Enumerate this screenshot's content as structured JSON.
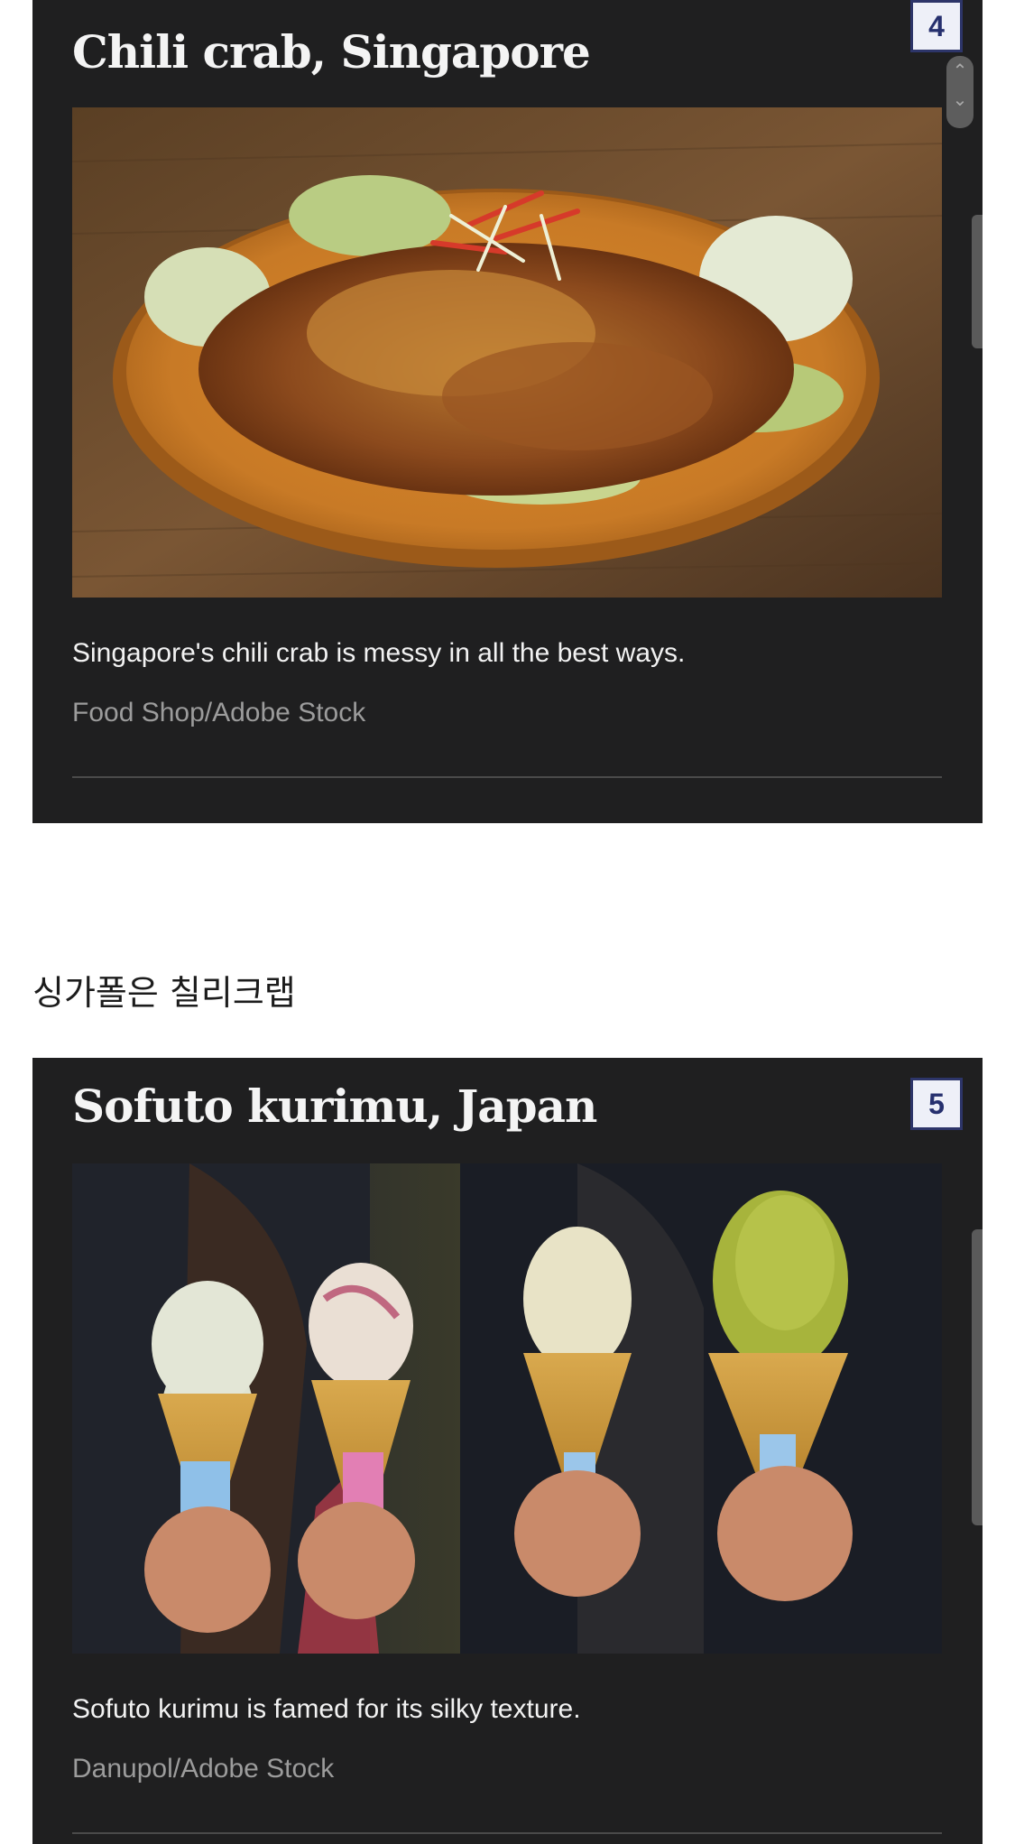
{
  "slides": [
    {
      "title": "Chili crab, Singapore",
      "badge": "4",
      "image_subject": "Chili crab served on an orange plate with lettuce",
      "caption": "Singapore's chili crab is messy in all the best ways.",
      "credit": "Food Shop/Adobe Stock"
    },
    {
      "title": "Sofuto kurimu, Japan",
      "badge": "5",
      "image_subject": "Four hands holding soft serve ice cream cones",
      "caption": "Sofuto kurimu is famed for its silky texture.",
      "credit": "Danupol/Adobe Stock"
    }
  ],
  "article": {
    "paragraph": "싱가폴은 칠리크랩"
  },
  "colors": {
    "card_background": "#1f1f20",
    "badge_border": "#2d3569",
    "caption_text": "#f2f2f2",
    "credit_text": "#9c9c9c"
  },
  "icons": {
    "scroll_up": "chevron-up-icon",
    "scroll_down": "chevron-down-icon"
  }
}
